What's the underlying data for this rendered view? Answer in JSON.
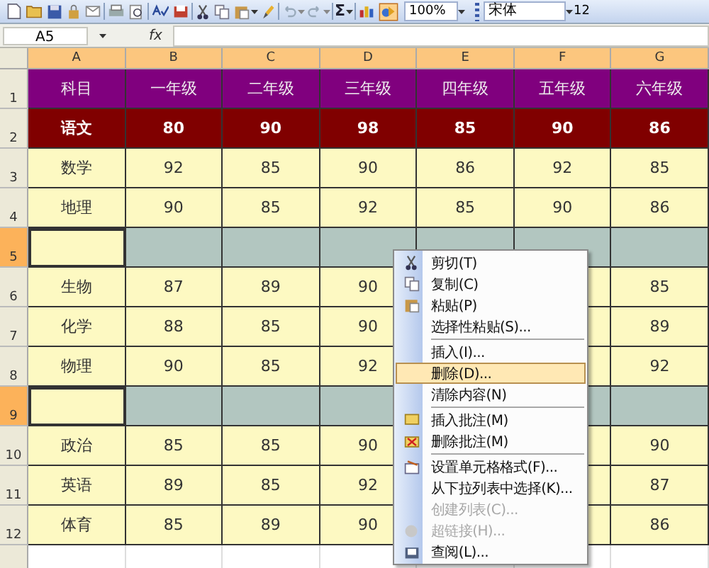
{
  "toolbar": {
    "sum_label": "Σ",
    "zoom": "100%",
    "font": "宋体",
    "font_size": "12"
  },
  "formula_bar": {
    "name_box": "A5",
    "fx_label": "fx"
  },
  "columns": [
    {
      "label": "A",
      "selected": true
    },
    {
      "label": "B",
      "selected": true
    },
    {
      "label": "C",
      "selected": true
    },
    {
      "label": "D",
      "selected": true
    },
    {
      "label": "E",
      "selected": true
    },
    {
      "label": "F",
      "selected": true
    },
    {
      "label": "G",
      "selected": true
    }
  ],
  "rows": [
    {
      "number": "1",
      "kind": "header",
      "selected": false,
      "cells": [
        "科目",
        "一年级",
        "二年级",
        "三年级",
        "四年级",
        "五年级",
        "六年级"
      ]
    },
    {
      "number": "2",
      "kind": "highlight",
      "selected": false,
      "cells": [
        "语文",
        "80",
        "90",
        "98",
        "85",
        "90",
        "86"
      ]
    },
    {
      "number": "3",
      "kind": "data",
      "selected": false,
      "cells": [
        "数学",
        "92",
        "85",
        "90",
        "86",
        "92",
        "85"
      ]
    },
    {
      "number": "4",
      "kind": "data",
      "selected": false,
      "cells": [
        "地理",
        "90",
        "85",
        "92",
        "85",
        "90",
        "86"
      ]
    },
    {
      "number": "5",
      "kind": "blank",
      "selected": true,
      "cells": [
        null,
        null,
        null,
        null,
        null,
        null,
        null
      ]
    },
    {
      "number": "6",
      "kind": "data",
      "selected": false,
      "cells": [
        "生物",
        "87",
        "89",
        "90",
        null,
        null,
        "85"
      ]
    },
    {
      "number": "7",
      "kind": "data",
      "selected": false,
      "cells": [
        "化学",
        "88",
        "85",
        "90",
        null,
        null,
        "89"
      ]
    },
    {
      "number": "8",
      "kind": "data",
      "selected": false,
      "cells": [
        "物理",
        "90",
        "85",
        "92",
        null,
        null,
        "92"
      ]
    },
    {
      "number": "9",
      "kind": "blank",
      "selected": true,
      "cells": [
        null,
        null,
        null,
        null,
        null,
        null,
        null
      ]
    },
    {
      "number": "10",
      "kind": "data",
      "selected": false,
      "cells": [
        "政治",
        "85",
        "85",
        "90",
        null,
        null,
        "90"
      ]
    },
    {
      "number": "11",
      "kind": "data",
      "selected": false,
      "cells": [
        "英语",
        "89",
        "85",
        "92",
        null,
        null,
        "87"
      ]
    },
    {
      "number": "12",
      "kind": "data",
      "selected": false,
      "cells": [
        "体育",
        "85",
        "89",
        "90",
        null,
        null,
        "86"
      ]
    }
  ],
  "context_menu": {
    "groups": [
      [
        {
          "label": "剪切(T)",
          "selected": false,
          "disabled": false
        },
        {
          "label": "复制(C)",
          "selected": false,
          "disabled": false
        },
        {
          "label": "粘贴(P)",
          "selected": false,
          "disabled": false
        },
        {
          "label": "选择性粘贴(S)...",
          "selected": false,
          "disabled": false
        }
      ],
      [
        {
          "label": "插入(I)...",
          "selected": false,
          "disabled": false
        },
        {
          "label": "删除(D)...",
          "selected": true,
          "disabled": false
        },
        {
          "label": "清除内容(N)",
          "selected": false,
          "disabled": false
        }
      ],
      [
        {
          "label": "插入批注(M)",
          "selected": false,
          "disabled": false
        },
        {
          "label": "删除批注(M)",
          "selected": false,
          "disabled": false
        }
      ],
      [
        {
          "label": "设置单元格格式(F)...",
          "selected": false,
          "disabled": false
        },
        {
          "label": "从下拉列表中选择(K)...",
          "selected": false,
          "disabled": false
        },
        {
          "label": "创建列表(C)...",
          "selected": false,
          "disabled": true
        },
        {
          "label": "超链接(H)...",
          "selected": false,
          "disabled": true
        },
        {
          "label": "查阅(L)...",
          "selected": false,
          "disabled": false
        }
      ]
    ]
  }
}
